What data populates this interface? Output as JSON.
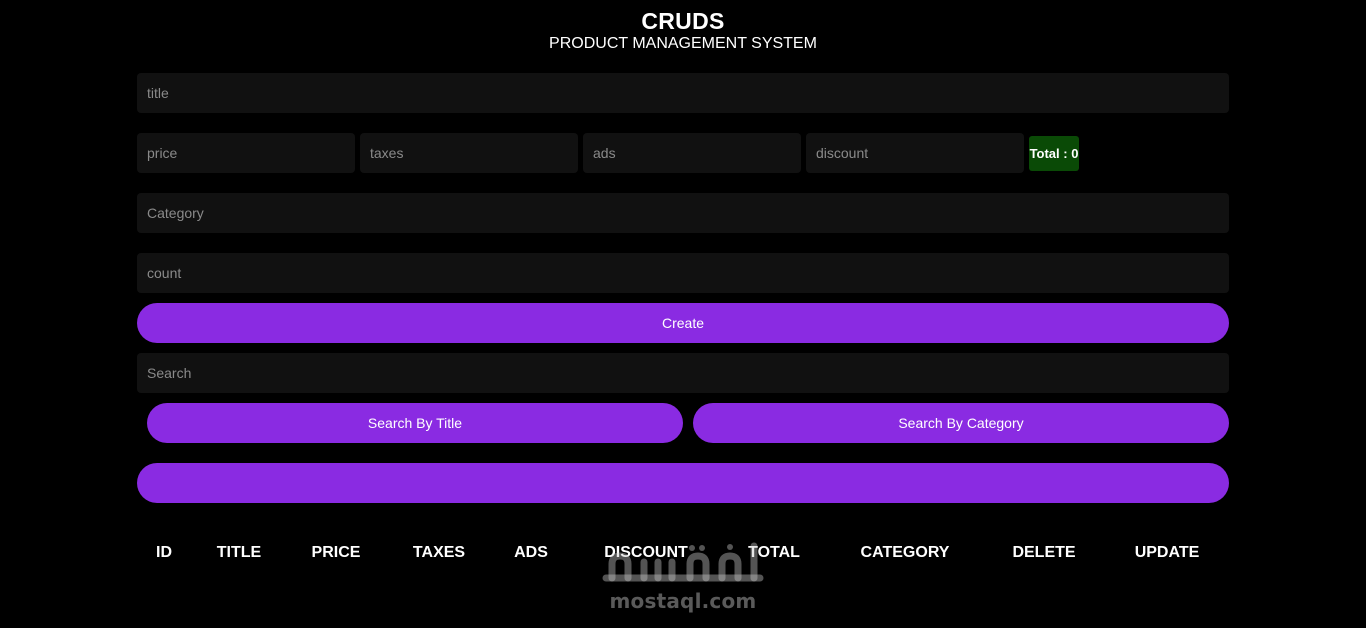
{
  "header": {
    "title": "CRUDS",
    "subtitle": "PRODUCT MANAGEMENT SYSTEM"
  },
  "form": {
    "title_placeholder": "title",
    "price_placeholder": "price",
    "taxes_placeholder": "taxes",
    "ads_placeholder": "ads",
    "discount_placeholder": "discount",
    "total_label": "Total : 0",
    "category_placeholder": "Category",
    "count_placeholder": "count",
    "create_label": "Create"
  },
  "search": {
    "placeholder": "Search",
    "by_title_label": "Search By Title",
    "by_category_label": "Search By Category",
    "delete_all_label": ""
  },
  "table": {
    "columns": [
      "ID",
      "TITLE",
      "PRICE",
      "TAXES",
      "ADS",
      "DISCOUNT",
      "TOTAL",
      "CATEGORY",
      "DELETE",
      "UPDATE"
    ]
  },
  "watermark": {
    "arabic_text": "مستقل",
    "latin_text": "mostaql.com"
  },
  "colors": {
    "background": "#000000",
    "input_bg": "#111111",
    "accent_purple": "#8a2be2",
    "total_green": "#0a4a06"
  }
}
